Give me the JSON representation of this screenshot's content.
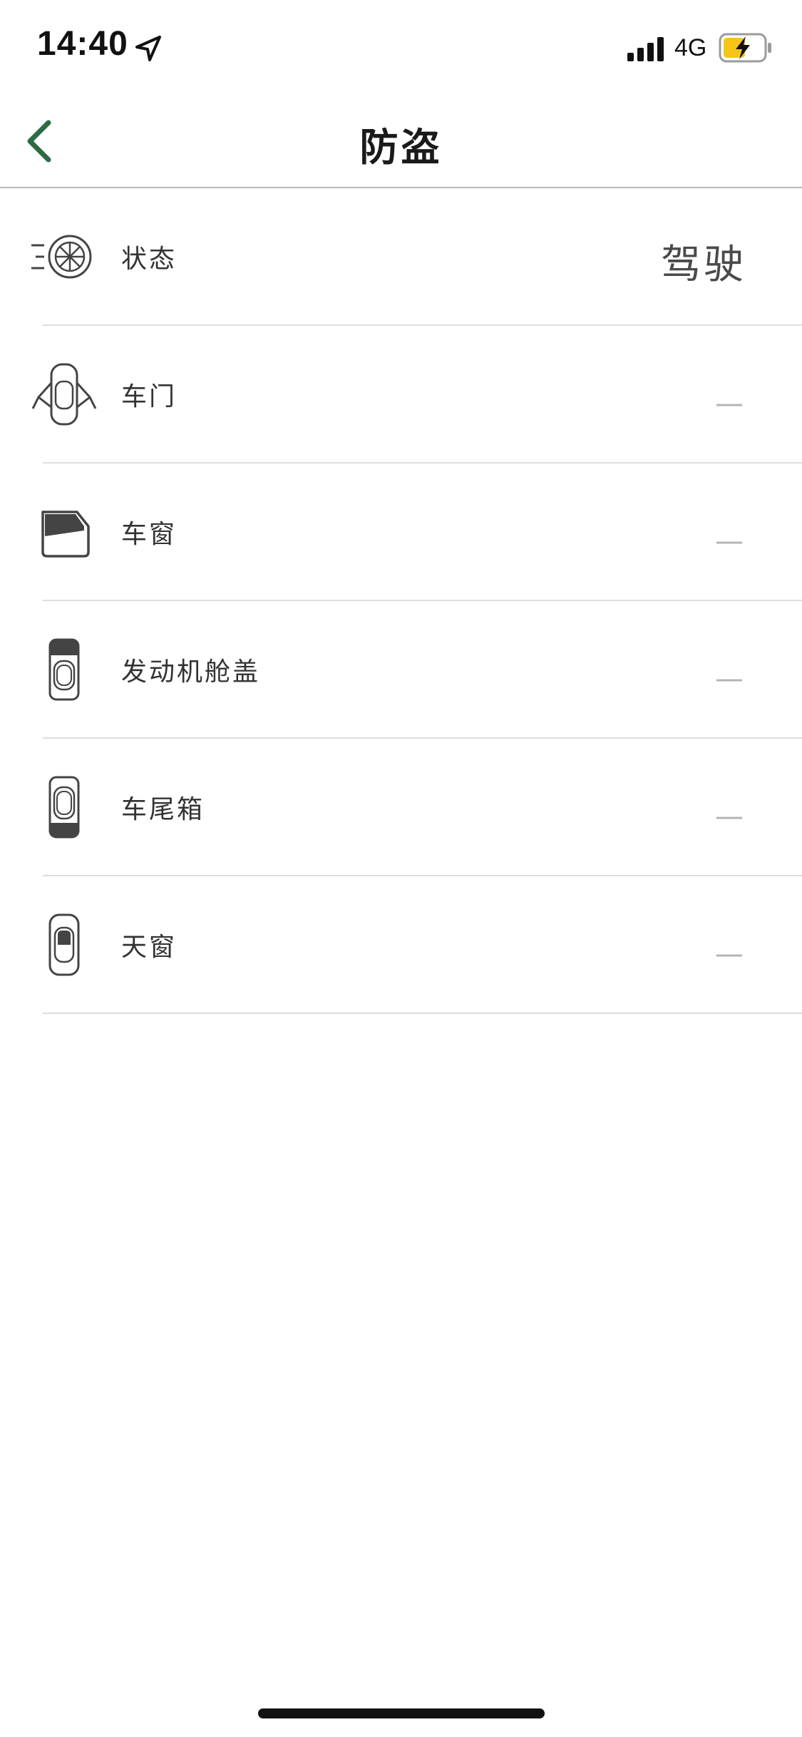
{
  "status_bar": {
    "time": "14:40",
    "network": "4G",
    "icons": [
      "location-arrow-icon",
      "signal-bars-icon",
      "battery-charging-icon"
    ],
    "battery_color": "#f5c518"
  },
  "nav": {
    "title": "防盗",
    "back_icon": "chevron-left-icon",
    "accent_color": "#2e6b45"
  },
  "rows": [
    {
      "label": "状态",
      "value": "驾驶",
      "icon": "spinning-wheel-icon"
    },
    {
      "label": "车门",
      "value": "—",
      "icon": "car-doors-open-icon"
    },
    {
      "label": "车窗",
      "value": "—",
      "icon": "car-window-icon"
    },
    {
      "label": "发动机舱盖",
      "value": "—",
      "icon": "car-hood-icon"
    },
    {
      "label": "车尾箱",
      "value": "—",
      "icon": "car-trunk-icon"
    },
    {
      "label": "天窗",
      "value": "—",
      "icon": "car-sunroof-icon"
    }
  ]
}
